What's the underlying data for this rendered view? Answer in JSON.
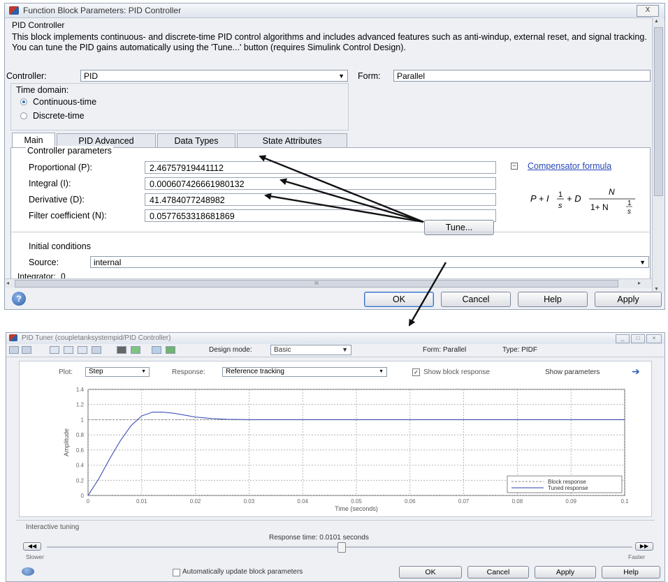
{
  "dialog1": {
    "title": "Function Block Parameters: PID Controller",
    "close_label": "X",
    "block_name": "PID Controller",
    "description": "This block implements continuous- and discrete-time PID control algorithms and includes advanced features such as anti-windup, external reset, and signal tracking. You can tune the PID gains automatically using the 'Tune...' button (requires Simulink Control Design).",
    "controller_label": "Controller:",
    "controller_value": "PID",
    "form_label": "Form:",
    "form_value": "Parallel",
    "time_domain_label": "Time domain:",
    "radio_continuous": "Continuous-time",
    "radio_discrete": "Discrete-time",
    "tabs": [
      "Main",
      "PID Advanced",
      "Data Types",
      "State Attributes"
    ],
    "group_label": "Controller parameters",
    "params": [
      {
        "label": "Proportional (P):",
        "value": "2.46757919441112"
      },
      {
        "label": "Integral (I):",
        "value": "0.000607426661980132"
      },
      {
        "label": "Derivative (D):",
        "value": "41.4784077248982"
      },
      {
        "label": "Filter coefficient (N):",
        "value": "0.0577653318681869"
      }
    ],
    "compensator_link": "Compensator formula",
    "tune_button": "Tune...",
    "initial_conditions_label": "Initial conditions",
    "source_label": "Source:",
    "source_value": "internal",
    "integrator_label": "Integrator:",
    "integrator_value": "0",
    "scroll_mid": "III",
    "buttons": {
      "ok": "OK",
      "cancel": "Cancel",
      "help": "Help",
      "apply": "Apply"
    }
  },
  "dialog2": {
    "title": "PID Tuner (coupletanksystempid/PID Controller)",
    "design_mode_label": "Design mode:",
    "design_mode_value": "Basic",
    "form_text": "Form: Parallel",
    "type_text": "Type: PIDF",
    "plot_label": "Plot:",
    "plot_value": "Step",
    "response_label": "Response:",
    "response_value": "Reference tracking",
    "show_block_response": "Show block response",
    "show_parameters": "Show parameters",
    "interactive_tuning": "Interactive tuning",
    "response_time_text": "Response time: 0.0101 seconds",
    "slower": "Slower",
    "faster": "Faster",
    "auto_update": "Automatically update block parameters",
    "buttons": {
      "ok": "OK",
      "cancel": "Cancel",
      "apply": "Apply",
      "help": "Help"
    }
  },
  "chart_data": {
    "type": "line",
    "xlabel": "Time (seconds)",
    "ylabel": "Amplitude",
    "xlim": [
      0,
      0.1
    ],
    "ylim": [
      0,
      1.4
    ],
    "xticks": [
      "0",
      "0.01",
      "0.02",
      "0.03",
      "0.04",
      "0.05",
      "0.06",
      "0.07",
      "0.08",
      "0.09",
      "0.1"
    ],
    "yticks": [
      "0",
      "0.2",
      "0.4",
      "0.6",
      "0.8",
      "1",
      "1.2",
      "1.4"
    ],
    "grid": true,
    "legend_position": "bottom-right",
    "series": [
      {
        "name": "Block response",
        "x": [
          0,
          0.1
        ],
        "y": [
          1,
          1
        ]
      },
      {
        "name": "Tuned response",
        "x": [
          0,
          0.002,
          0.004,
          0.006,
          0.008,
          0.01,
          0.012,
          0.014,
          0.016,
          0.018,
          0.02,
          0.023,
          0.026,
          0.03,
          0.035,
          0.04,
          0.05,
          0.06,
          0.07,
          0.08,
          0.09,
          0.1
        ],
        "y": [
          0,
          0.22,
          0.48,
          0.72,
          0.92,
          1.05,
          1.1,
          1.1,
          1.085,
          1.06,
          1.035,
          1.015,
          1.005,
          1.0,
          1.0,
          1.0,
          1.0,
          1.0,
          1.0,
          1.0,
          1.0,
          1.0
        ]
      }
    ]
  }
}
